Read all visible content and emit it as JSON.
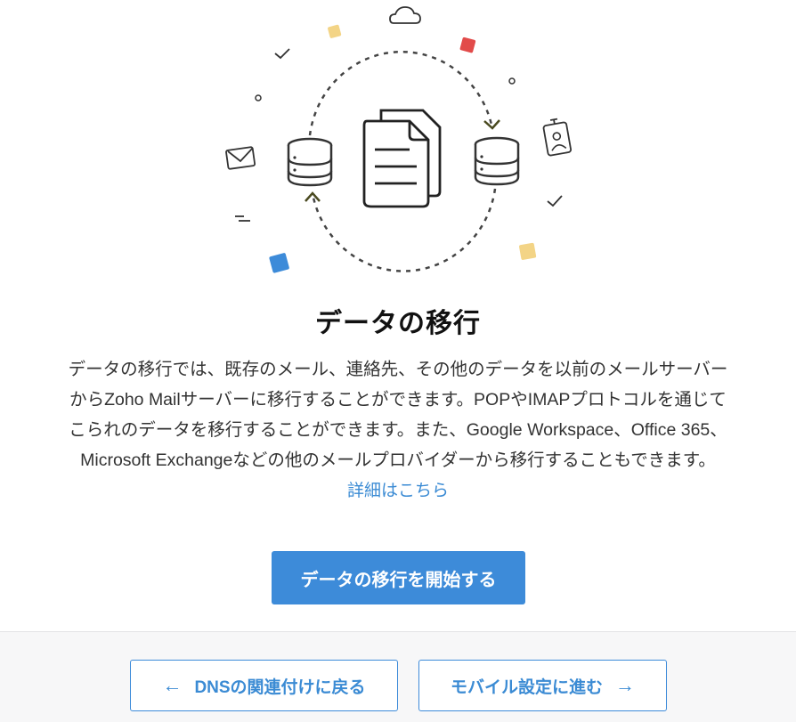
{
  "colors": {
    "accent": "#3d8bd9",
    "link": "#3b8bd4",
    "confetti_yellow": "#f3d486",
    "confetti_red": "#e24b4a",
    "confetti_blue": "#3d8bd9"
  },
  "illustration": {
    "icons": [
      "cloud-icon",
      "database-icon",
      "document-icon",
      "mail-icon",
      "id-card-icon",
      "checkmark-icon"
    ]
  },
  "main": {
    "title": "データの移行",
    "description_lines": [
      "データの移行では、既存のメール、連絡先、その他のデータを以前のメールサーバー",
      "からZoho Mailサーバーに移行することができます。POPやIMAPプロトコルを通じて",
      "こられのデータを移行することができます。また、Google Workspace、Office 365、",
      "Microsoft Exchangeなどの他のメールプロバイダーから移行することもできます。"
    ],
    "learn_more": "詳細はこちら",
    "start_button": "データの移行を開始する"
  },
  "footer": {
    "back_button": "DNSの関連付けに戻る",
    "back_arrow": "←",
    "next_button": "モバイル設定に進む",
    "next_arrow": "→"
  }
}
